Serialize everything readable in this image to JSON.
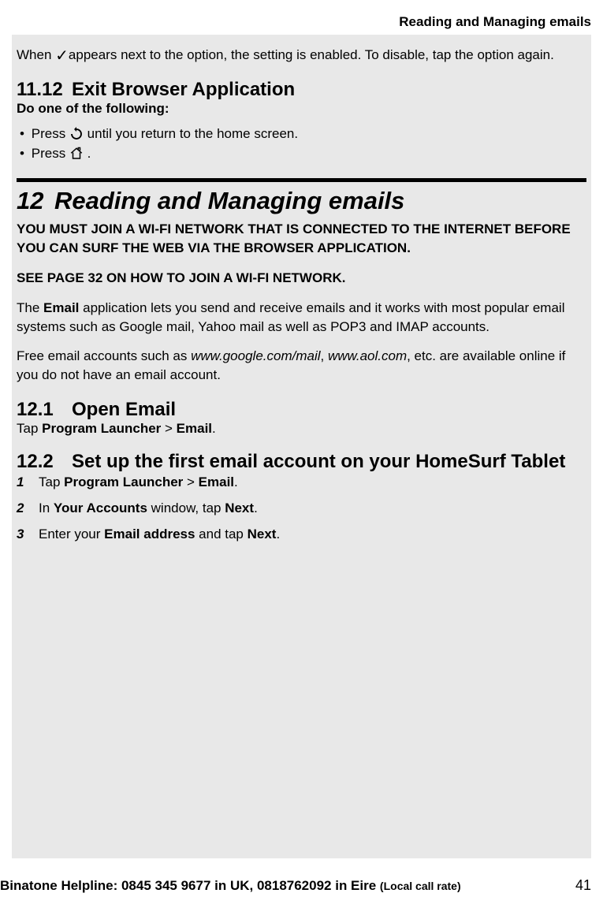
{
  "header": {
    "running_title": "Reading and Managing emails"
  },
  "intro": {
    "when_prefix": "When ",
    "when_suffix": "appears next to the option, the setting is enabled. To disable, tap the option again."
  },
  "section_11_12": {
    "number": "11.12",
    "title": "Exit Browser Application",
    "subtitle": "Do one of the following:",
    "bullet1_prefix": "Press ",
    "bullet1_suffix": " until you return to the home screen.",
    "bullet2_prefix": "Press ",
    "bullet2_suffix": "."
  },
  "chapter_12": {
    "number": "12",
    "title": "Reading and Managing emails",
    "caps1": "YOU MUST JOIN A WI-FI NETWORK THAT IS CONNECTED TO THE INTERNET BEFORE YOU CAN SURF THE WEB VIA THE BROWSER APPLICATION.",
    "caps2": "SEE PAGE 32 ON HOW TO JOIN A WI-FI NETWORK.",
    "para1_a": "The ",
    "para1_b": "Email",
    "para1_c": " application lets you send and receive emails and it works with most popular email systems such as Google mail, Yahoo mail as well as POP3 and IMAP accounts.",
    "para2_a": "Free email accounts such as ",
    "para2_b": "www.google.com/mail",
    "para2_c": ", ",
    "para2_d": "www.aol.com",
    "para2_e": ", etc. are available online if you do not have an email account."
  },
  "section_12_1": {
    "number": "12.1",
    "title": "Open Email",
    "follow_a": "Tap ",
    "follow_b": "Program Launcher",
    "follow_c": " > ",
    "follow_d": "Email",
    "follow_e": "."
  },
  "section_12_2": {
    "number": "12.2",
    "title": "Set up the first email account on your HomeSurf Tablet",
    "steps": [
      {
        "n": "1",
        "a": "Tap ",
        "b": "Program Launcher",
        "c": " > ",
        "d": "Email",
        "e": "."
      },
      {
        "n": "2",
        "a": "In ",
        "b": "Your Accounts",
        "c": " window, tap ",
        "d": "Next",
        "e": "."
      },
      {
        "n": "3",
        "a": "Enter your ",
        "b": "Email address",
        "c": " and tap ",
        "d": "Next",
        "e": "."
      }
    ]
  },
  "footer": {
    "helpline_a": "Binatone Helpline: 0845 345 9677 in UK, 0818762092 in Eire ",
    "helpline_b": "(Local call rate)",
    "page_number": "41"
  }
}
